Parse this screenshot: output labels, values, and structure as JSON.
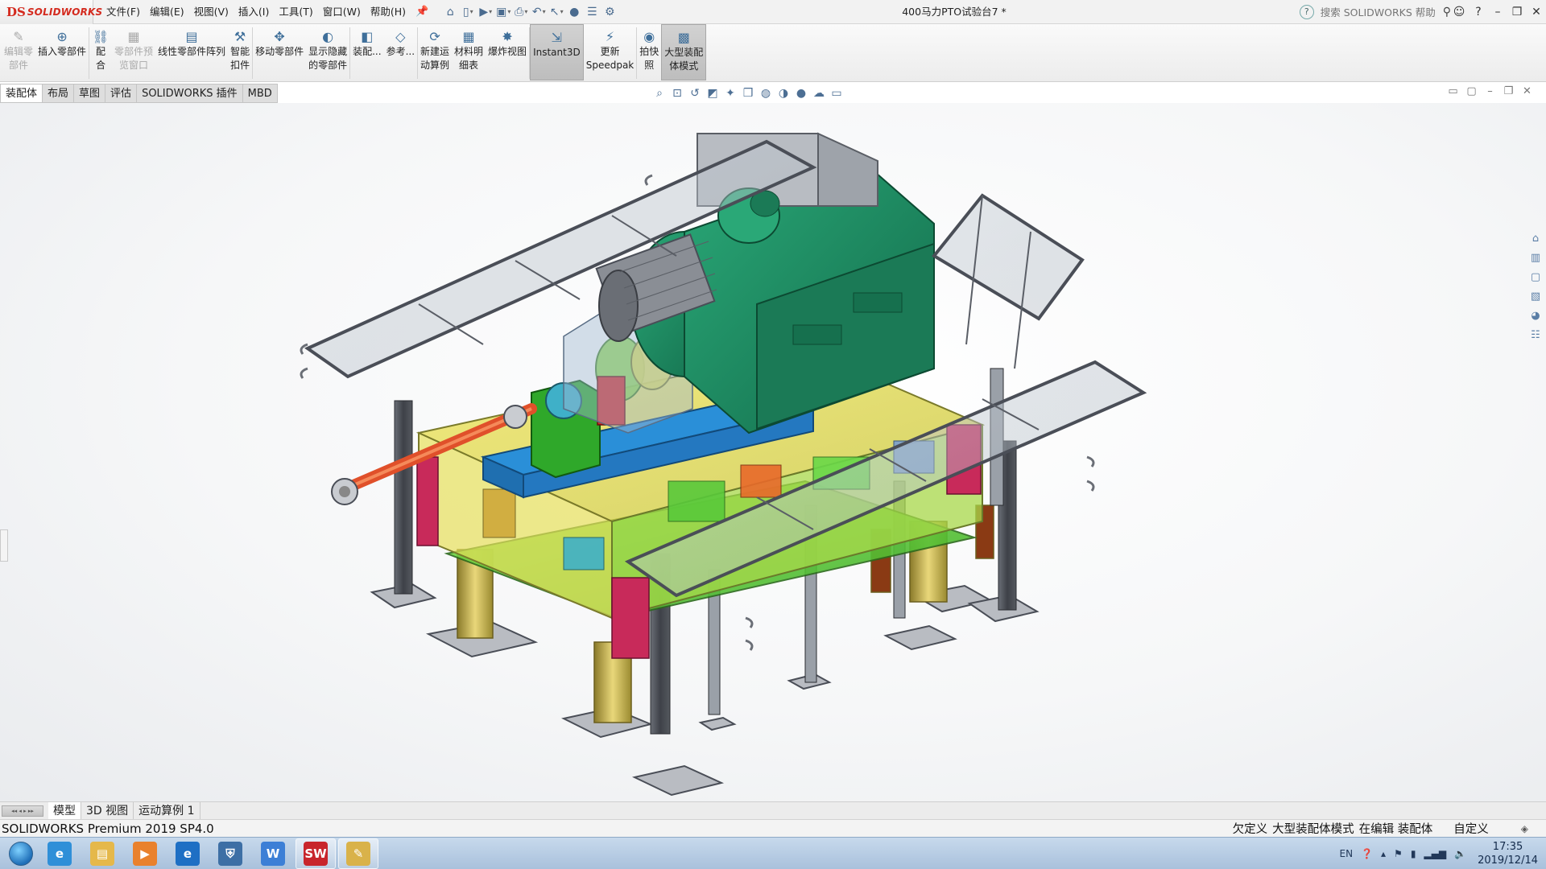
{
  "app": {
    "logo_mark": "DS",
    "logo_name": "SOLIDWORKS",
    "doc_title": "400马力PTO试验台7 *"
  },
  "menus": [
    "文件(F)",
    "编辑(E)",
    "视图(V)",
    "插入(I)",
    "工具(T)",
    "窗口(W)",
    "帮助(H)"
  ],
  "quick_icons": [
    "home-icon",
    "new-document-icon",
    "open-icon",
    "save-icon",
    "print-icon",
    "undo-icon",
    "select-icon",
    "rebuild-icon",
    "file-properties-icon",
    "options-icon"
  ],
  "help": {
    "search_placeholder": "搜索 SOLIDWORKS 帮助"
  },
  "ribbon": [
    {
      "id": "edit-component",
      "label": "编辑零\n部件",
      "icon": "edit-component-icon",
      "disabled": true
    },
    {
      "id": "insert-component",
      "label": "插入零部件",
      "icon": "insert-component-icon"
    },
    {
      "id": "mate",
      "label": "配\n合",
      "icon": "mate-icon"
    },
    {
      "id": "component-preview",
      "label": "零部件预\n览窗口",
      "icon": "preview-window-icon",
      "disabled": true
    },
    {
      "id": "linear-pattern",
      "label": "线性零部件阵列",
      "icon": "linear-pattern-icon"
    },
    {
      "id": "smart-fasteners",
      "label": "智能\n扣件",
      "icon": "smart-fasteners-icon"
    },
    {
      "id": "move-component",
      "label": "移动零部件",
      "icon": "move-component-icon"
    },
    {
      "id": "show-hidden",
      "label": "显示隐藏\n的零部件",
      "icon": "show-hidden-icon"
    },
    {
      "id": "assembly-features",
      "label": "装配...",
      "icon": "assembly-features-icon"
    },
    {
      "id": "reference",
      "label": "参考...",
      "icon": "reference-geometry-icon"
    },
    {
      "id": "new-motion-study",
      "label": "新建运\n动算例",
      "icon": "motion-study-icon"
    },
    {
      "id": "bom",
      "label": "材料明\n细表",
      "icon": "bill-of-materials-icon"
    },
    {
      "id": "exploded-view",
      "label": "爆炸视图",
      "icon": "exploded-view-icon"
    },
    {
      "id": "instant3d",
      "label": "Instant3D",
      "icon": "instant3d-icon",
      "active": true
    },
    {
      "id": "update-speedpak",
      "label": "更新\nSpeedpak",
      "icon": "speedpak-icon"
    },
    {
      "id": "snapshot",
      "label": "拍快\n照",
      "icon": "camera-icon"
    },
    {
      "id": "large-assembly-mode",
      "label": "大型装配\n体模式",
      "icon": "large-assembly-icon",
      "active": true
    }
  ],
  "tabs": [
    "装配体",
    "布局",
    "草图",
    "评估",
    "SOLIDWORKS 插件",
    "MBD"
  ],
  "hud_icons": [
    "zoom-to-fit-icon",
    "zoom-area-icon",
    "previous-view-icon",
    "section-view-icon",
    "dynamic-annotation-icon",
    "view-orientation-icon",
    "display-style-icon",
    "hide-show-icon",
    "edit-appearance-icon",
    "apply-scene-icon",
    "view-settings-icon"
  ],
  "taskpane_icons": [
    "resources-icon",
    "design-library-icon",
    "file-explorer-icon",
    "view-palette-icon",
    "appearances-icon",
    "custom-properties-icon"
  ],
  "bottom_tabs": [
    "模型",
    "3D 视图",
    "运动算例 1"
  ],
  "status": {
    "version": "SOLIDWORKS Premium 2019 SP4.0",
    "state": "欠定义",
    "mode": "大型装配体模式",
    "editing": "在编辑 装配体",
    "units": "自定义"
  },
  "taskbar": {
    "apps": [
      {
        "name": "ie-app",
        "glyph": "e",
        "color": "#2f8fd8"
      },
      {
        "name": "explorer-app",
        "glyph": "▤",
        "color": "#e5b84a"
      },
      {
        "name": "media-player-app",
        "glyph": "▶",
        "color": "#e9812d"
      },
      {
        "name": "ie-app-2",
        "glyph": "e",
        "color": "#1e6fc4"
      },
      {
        "name": "security-app",
        "glyph": "⛨",
        "color": "#3d6fa5"
      },
      {
        "name": "wps-app",
        "glyph": "W",
        "color": "#3c7fd6"
      },
      {
        "name": "solidworks-app",
        "glyph": "SW",
        "color": "#c8252c",
        "running": true
      },
      {
        "name": "paint-app",
        "glyph": "✎",
        "color": "#d9b24a",
        "running": true
      }
    ],
    "tray": {
      "lang": "EN",
      "time": "17:35",
      "date": "2019/12/14"
    }
  },
  "colors": {
    "accent": "#d42a1e",
    "motor": "#1f8a63",
    "base": "#2a8fd8",
    "shaft": "#e0502a",
    "frame": "#4a4e57"
  }
}
